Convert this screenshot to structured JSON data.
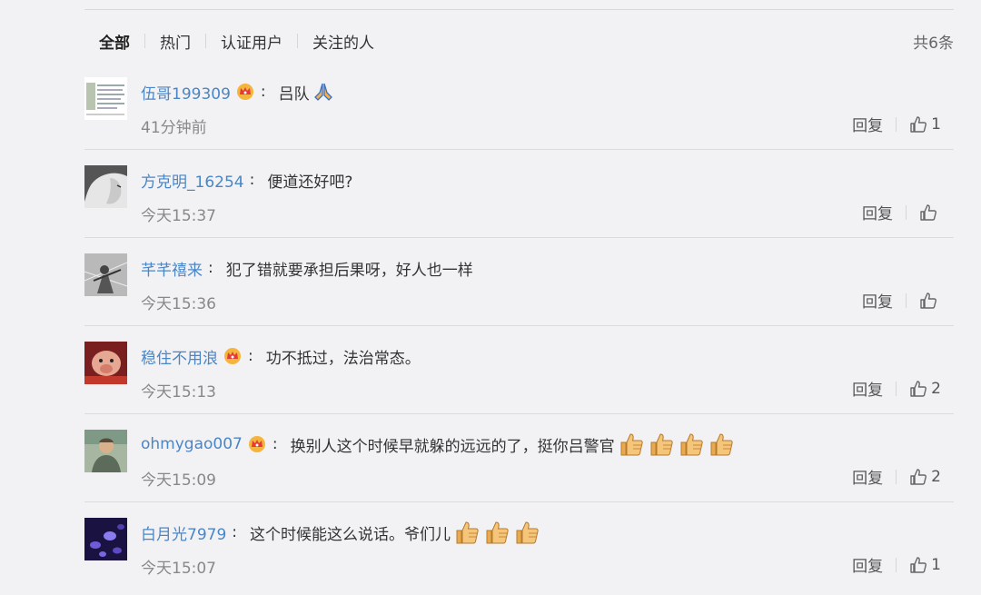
{
  "tabs": [
    {
      "label": "全部",
      "active": true
    },
    {
      "label": "热门",
      "active": false
    },
    {
      "label": "认证用户",
      "active": false
    },
    {
      "label": "关注的人",
      "active": false
    }
  ],
  "total": "共6条",
  "actions": {
    "reply_label": "回复"
  },
  "colors": {
    "username": "#4a86c6",
    "text": "#333333",
    "meta": "#888888",
    "background": "#f2f2f5"
  },
  "comments": [
    {
      "username": "伍哥199309",
      "vip": true,
      "text": "吕队",
      "emoji_after": [
        "pray"
      ],
      "time": "41分钟前",
      "likes": "1"
    },
    {
      "username": "方克明_16254",
      "vip": false,
      "text": "便道还好吧?",
      "emoji_after": [],
      "time": "今天15:37",
      "likes": ""
    },
    {
      "username": "芊芊禧来",
      "vip": false,
      "text": "犯了错就要承担后果呀，好人也一样",
      "emoji_after": [],
      "time": "今天15:36",
      "likes": ""
    },
    {
      "username": "稳住不用浪",
      "vip": true,
      "text": "功不抵过，法治常态。",
      "emoji_after": [],
      "time": "今天15:13",
      "likes": "2"
    },
    {
      "username": "ohmygao007",
      "vip": true,
      "text": "换别人这个时候早就躲的远远的了，挺你吕警官",
      "emoji_after": [
        "thumbs-up",
        "thumbs-up",
        "thumbs-up",
        "thumbs-up"
      ],
      "time": "今天15:09",
      "likes": "2"
    },
    {
      "username": "白月光7979",
      "vip": false,
      "text": "这个时候能这么说话。爷们儿",
      "emoji_after": [
        "thumbs-up",
        "thumbs-up",
        "thumbs-up"
      ],
      "time": "今天15:07",
      "likes": "1"
    }
  ]
}
